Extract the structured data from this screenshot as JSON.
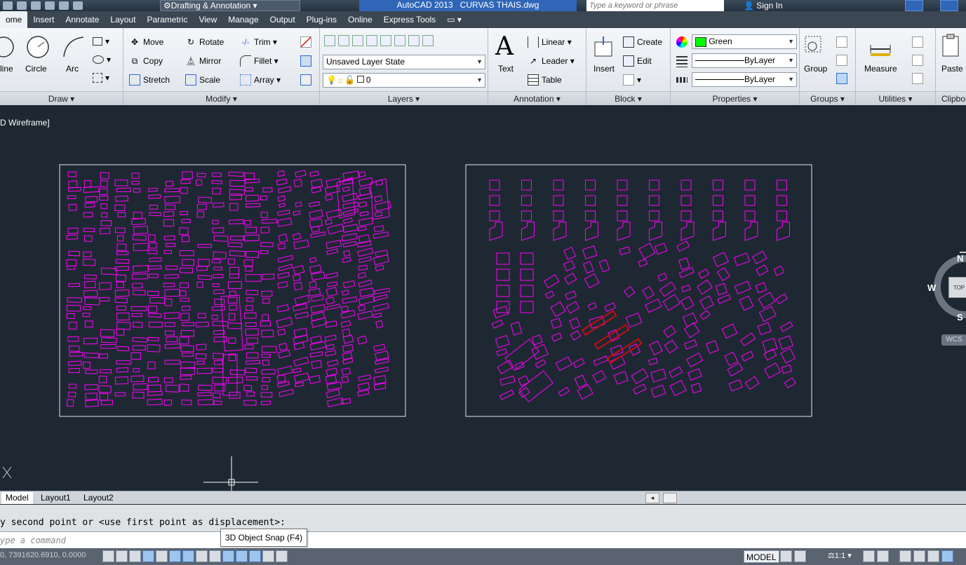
{
  "window": {
    "workspace": "Drafting & Annotation",
    "app_title": "AutoCAD 2013",
    "file_name": "CURVAS THAIS.dwg",
    "search_placeholder": "Type a keyword or phrase",
    "sign_in": "Sign In"
  },
  "ribbon_tabs": [
    "ome",
    "Insert",
    "Annotate",
    "Layout",
    "Parametric",
    "View",
    "Manage",
    "Output",
    "Plug-ins",
    "Online",
    "Express Tools"
  ],
  "draw": {
    "line": "line",
    "circle": "Circle",
    "arc": "Arc",
    "title": "Draw ▾"
  },
  "modify": {
    "move": "Move",
    "rotate": "Rotate",
    "trim": "Trim ▾",
    "copy": "Copy",
    "mirror": "Mirror",
    "fillet": "Fillet ▾",
    "stretch": "Stretch",
    "scale": "Scale",
    "array": "Array ▾",
    "title": "Modify ▾"
  },
  "layers": {
    "state": "Unsaved Layer State",
    "current": "0",
    "title": "Layers ▾"
  },
  "annotation": {
    "text": "Text",
    "linear": "Linear ▾",
    "leader": "Leader ▾",
    "table": "Table",
    "title": "Annotation ▾"
  },
  "block": {
    "insert": "Insert",
    "create": "Create",
    "edit": "Edit",
    "title": "Block ▾"
  },
  "properties": {
    "color": "Green",
    "linetype": "ByLayer",
    "lineweight": "ByLayer",
    "title": "Properties ▾",
    "color_hex": "#00ff00"
  },
  "groups": {
    "group": "Group",
    "title": "Groups ▾"
  },
  "utilities": {
    "measure": "Measure",
    "title": "Utilities ▾"
  },
  "clipboard": {
    "paste": "Paste",
    "title": "Clipbo"
  },
  "viewport": {
    "label": "D Wireframe]"
  },
  "viewcube": {
    "n": "N",
    "w": "W",
    "s": "S",
    "top": "TOP",
    "wcs": "WCS"
  },
  "layout_tabs": [
    "Model",
    "Layout1",
    "Layout2"
  ],
  "command": {
    "history": "y second point or <use first point as displacement>:",
    "placeholder": "ype a command",
    "tooltip": "3D Object Snap (F4)"
  },
  "status": {
    "coords": "0, 7391620.6910, 0.0000",
    "model": "MODEL",
    "scale": "1:1 ▾"
  },
  "colors": {
    "drawing_lines": "#ff00ff",
    "highlight": "#c01010",
    "background": "#1e2832"
  }
}
